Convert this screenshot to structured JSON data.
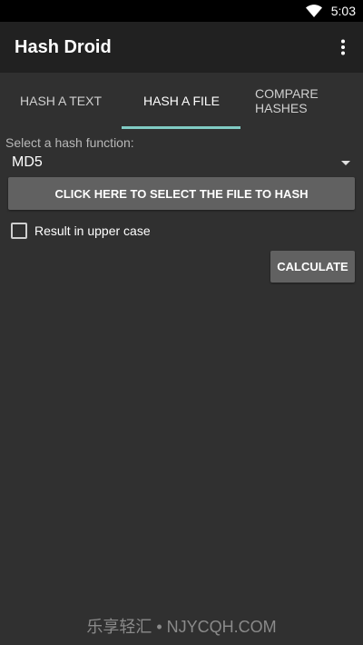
{
  "status_bar": {
    "time": "5:03",
    "wifi_icon": "wifi-icon"
  },
  "app_bar": {
    "title": "Hash Droid",
    "overflow_icon": "overflow-menu-icon"
  },
  "tabs": [
    {
      "label": "HASH A TEXT",
      "selected": false
    },
    {
      "label": "HASH A FILE",
      "selected": true
    },
    {
      "label_line1": "COMPARE",
      "label_line2": "HASHES",
      "selected": false
    }
  ],
  "form": {
    "hash_label": "Select a hash function:",
    "hash_function": "MD5",
    "select_file_button": "CLICK HERE TO SELECT THE FILE TO HASH",
    "uppercase_label": "Result in upper case",
    "uppercase_checked": false,
    "calculate_button": "CALCULATE"
  },
  "watermark": "乐享轻汇 • NJYCQH.COM",
  "colors": {
    "background": "#303030",
    "app_bar": "#212121",
    "accent": "#80cbc4",
    "button": "#616161"
  }
}
